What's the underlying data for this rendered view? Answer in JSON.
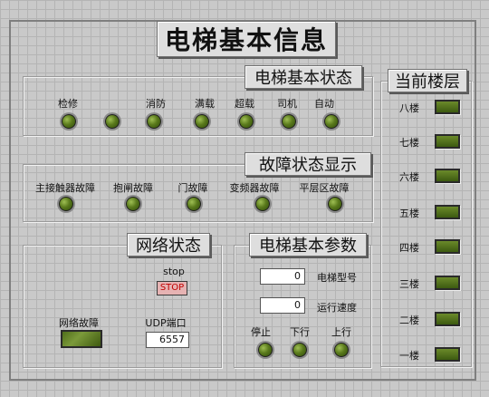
{
  "window": {
    "title": "电梯基本信息"
  },
  "status": {
    "title": "电梯基本状态",
    "items": [
      {
        "label": "自动",
        "on": false
      },
      {
        "label": "司机",
        "on": false
      },
      {
        "label": "超载",
        "on": false
      },
      {
        "label": "满载",
        "on": false
      },
      {
        "label": "消防",
        "on": false
      },
      {
        "label": "检修",
        "on": false
      }
    ]
  },
  "faults": {
    "title": "故障状态显示",
    "items": [
      {
        "label": "平层区故障",
        "on": false
      },
      {
        "label": "变频器故障",
        "on": false
      },
      {
        "label": "门故障",
        "on": false
      },
      {
        "label": "抱闸故障",
        "on": false
      },
      {
        "label": "主接触器故障",
        "on": false
      }
    ]
  },
  "floors": {
    "title": "当前楼层",
    "items": [
      {
        "label": "八楼",
        "on": false
      },
      {
        "label": "七楼",
        "on": false
      },
      {
        "label": "六楼",
        "on": false
      },
      {
        "label": "五楼",
        "on": false
      },
      {
        "label": "四楼",
        "on": false
      },
      {
        "label": "三楼",
        "on": false
      },
      {
        "label": "二楼",
        "on": false
      },
      {
        "label": "一楼",
        "on": false
      }
    ]
  },
  "network": {
    "title": "网络状态",
    "stop_label": "stop",
    "stop_button": "STOP",
    "udp_label": "UDP端口",
    "udp_port": "6557",
    "fault_label": "网络故障"
  },
  "params": {
    "title": "电梯基本参数",
    "model_label": "电梯型号",
    "model_value": "0",
    "speed_label": "运行速度",
    "speed_value": "0",
    "dirs": [
      {
        "label": "上行",
        "on": false
      },
      {
        "label": "下行",
        "on": false
      },
      {
        "label": "停止",
        "on": false
      }
    ]
  },
  "colors": {
    "background": "#c9c9c9",
    "led_off": "#4a6a18",
    "stop_text": "#c00000"
  }
}
